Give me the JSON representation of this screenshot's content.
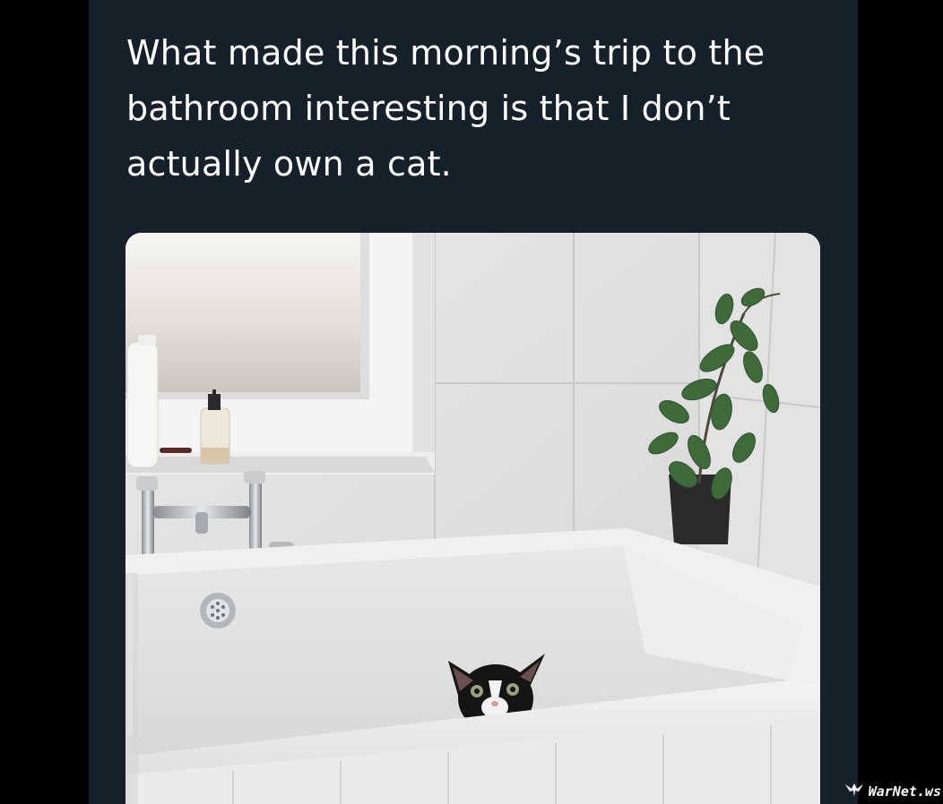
{
  "post": {
    "text": "What made this morning’s trip to the bathroom interesting is that I don’t actually own a cat."
  },
  "watermark": {
    "text": "WarNet.ws",
    "icon": "eagle-icon"
  },
  "colors": {
    "page_background": "#000000",
    "panel_background": "#15202b",
    "text": "#ffffff"
  }
}
